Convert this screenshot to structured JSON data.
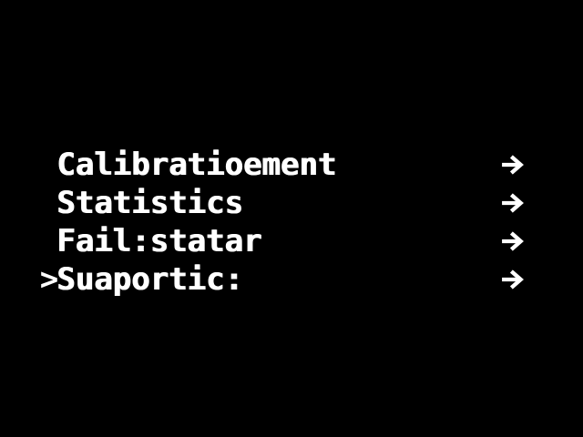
{
  "screen": {
    "background_color": "#000000",
    "text_color": "#ffffff"
  },
  "menu": {
    "cursor": ">",
    "items": [
      {
        "label": "Calibratioement",
        "arrow_icon": "arrow-right-icon",
        "selected": false
      },
      {
        "label": "Statistics",
        "arrow_icon": "arrow-right-icon",
        "selected": false
      },
      {
        "label": "Fail:statar",
        "arrow_icon": "arrow-right-icon",
        "selected": false
      },
      {
        "label": "Suaportic:",
        "arrow_icon": "arrow-right-icon",
        "selected": true
      }
    ]
  }
}
